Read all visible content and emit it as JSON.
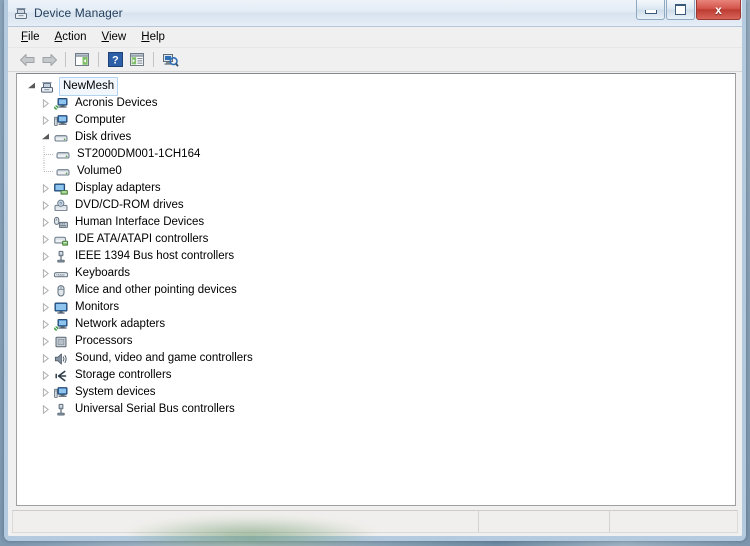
{
  "window": {
    "title": "Device Manager",
    "title_icon": "device-manager-icon",
    "caption": {
      "minimize_label": "Minimize",
      "maximize_label": "Maximize",
      "close_label": "x"
    }
  },
  "menubar": {
    "items": [
      {
        "label": "File",
        "accel": "F"
      },
      {
        "label": "Action",
        "accel": "A"
      },
      {
        "label": "View",
        "accel": "V"
      },
      {
        "label": "Help",
        "accel": "H"
      }
    ]
  },
  "toolbar": {
    "buttons": [
      {
        "name": "back-button",
        "icon": "arrow-left-icon",
        "enabled": false
      },
      {
        "name": "forward-button",
        "icon": "arrow-right-icon",
        "enabled": false
      },
      {
        "name": "show-hide-tree-button",
        "icon": "tree-pane-icon",
        "enabled": true
      },
      {
        "name": "help-button",
        "icon": "question-mark-icon",
        "enabled": true
      },
      {
        "name": "properties-button",
        "icon": "properties-icon",
        "enabled": true
      },
      {
        "name": "scan-hardware-button",
        "icon": "scan-hardware-icon",
        "enabled": true
      }
    ]
  },
  "tree": {
    "root": {
      "label": "NewMesh",
      "icon": "computer-root-icon",
      "expanded": true,
      "selected": true
    },
    "nodes": [
      {
        "label": "Acronis Devices",
        "icon": "network-device-icon",
        "expanded": false,
        "level": 1
      },
      {
        "label": "Computer",
        "icon": "computer-icon",
        "expanded": false,
        "level": 1
      },
      {
        "label": "Disk drives",
        "icon": "disk-drive-icon",
        "expanded": true,
        "level": 1
      },
      {
        "label": "ST2000DM001-1CH164",
        "icon": "disk-drive-icon",
        "expanded": null,
        "level": 2
      },
      {
        "label": "Volume0",
        "icon": "disk-drive-icon",
        "expanded": null,
        "level": 2,
        "last_child": true
      },
      {
        "label": "Display adapters",
        "icon": "display-adapter-icon",
        "expanded": false,
        "level": 1
      },
      {
        "label": "DVD/CD-ROM drives",
        "icon": "dvd-drive-icon",
        "expanded": false,
        "level": 1
      },
      {
        "label": "Human Interface Devices",
        "icon": "hid-icon",
        "expanded": false,
        "level": 1
      },
      {
        "label": "IDE ATA/ATAPI controllers",
        "icon": "ide-controller-icon",
        "expanded": false,
        "level": 1
      },
      {
        "label": "IEEE 1394 Bus host controllers",
        "icon": "ieee1394-icon",
        "expanded": false,
        "level": 1
      },
      {
        "label": "Keyboards",
        "icon": "keyboard-icon",
        "expanded": false,
        "level": 1
      },
      {
        "label": "Mice and other pointing devices",
        "icon": "mouse-icon",
        "expanded": false,
        "level": 1
      },
      {
        "label": "Monitors",
        "icon": "monitor-icon",
        "expanded": false,
        "level": 1
      },
      {
        "label": "Network adapters",
        "icon": "network-adapter-icon",
        "expanded": false,
        "level": 1
      },
      {
        "label": "Processors",
        "icon": "processor-icon",
        "expanded": false,
        "level": 1
      },
      {
        "label": "Sound, video and game controllers",
        "icon": "sound-icon",
        "expanded": false,
        "level": 1
      },
      {
        "label": "Storage controllers",
        "icon": "storage-controller-icon",
        "expanded": false,
        "level": 1
      },
      {
        "label": "System devices",
        "icon": "system-device-icon",
        "expanded": false,
        "level": 1
      },
      {
        "label": "Universal Serial Bus controllers",
        "icon": "usb-icon",
        "expanded": false,
        "level": 1,
        "last": true
      }
    ]
  },
  "statusbar": {
    "main_text": "",
    "pane_two_text": "",
    "pane_three_text": ""
  },
  "colors": {
    "accent_blue": "#2a5d9e",
    "title_text": "#26415e",
    "close_red": "#bd3c32",
    "selection_border": "#b4d3f0",
    "selection_fill": "#f2f7fd",
    "panel_bg": "#f0f0f0",
    "content_bg": "#ffffff"
  }
}
